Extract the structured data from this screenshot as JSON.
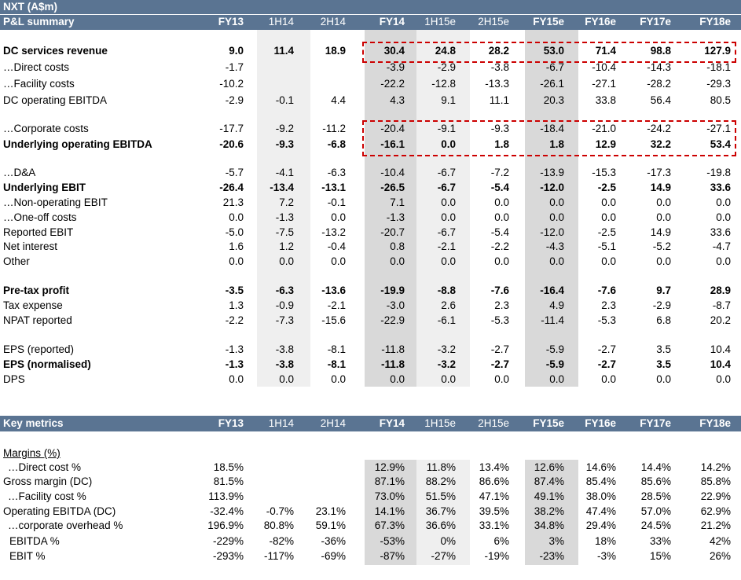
{
  "pl": {
    "title1": "NXT  (A$m)",
    "title2": "P&L summary",
    "columns": [
      "FY13",
      "1H14",
      "2H14",
      "FY14",
      "1H15e",
      "2H15e",
      "FY15e",
      "FY16e",
      "FY17e",
      "FY18e"
    ],
    "rows": [
      {
        "label": "DC services revenue",
        "bold": true,
        "values": [
          "9.0",
          "11.4",
          "18.9",
          "30.4",
          "24.8",
          "28.2",
          "53.0",
          "71.4",
          "98.8",
          "127.9"
        ]
      },
      {
        "label": "…Direct costs",
        "bold": false,
        "values": [
          "-1.7",
          "",
          "",
          "-3.9",
          "-2.9",
          "-3.8",
          "-6.7",
          "-10.4",
          "-14.3",
          "-18.1"
        ]
      },
      {
        "label": "…Facility costs",
        "bold": false,
        "values": [
          "-10.2",
          "",
          "",
          "-22.2",
          "-12.8",
          "-13.3",
          "-26.1",
          "-27.1",
          "-28.2",
          "-29.3"
        ]
      },
      {
        "label": "DC operating EBITDA",
        "bold": false,
        "values": [
          "-2.9",
          "-0.1",
          "4.4",
          "4.3",
          "9.1",
          "11.1",
          "20.3",
          "33.8",
          "56.4",
          "80.5"
        ]
      },
      {
        "label": "…Corporate costs",
        "bold": false,
        "values": [
          "-17.7",
          "-9.2",
          "-11.2",
          "-20.4",
          "-9.1",
          "-9.3",
          "-18.4",
          "-21.0",
          "-24.2",
          "-27.1"
        ]
      },
      {
        "label": "Underlying operating EBITDA",
        "bold": true,
        "values": [
          "-20.6",
          "-9.3",
          "-6.8",
          "-16.1",
          "0.0",
          "1.8",
          "1.8",
          "12.9",
          "32.2",
          "53.4"
        ]
      },
      {
        "label": "…D&A",
        "bold": false,
        "values": [
          "-5.7",
          "-4.1",
          "-6.3",
          "-10.4",
          "-6.7",
          "-7.2",
          "-13.9",
          "-15.3",
          "-17.3",
          "-19.8"
        ]
      },
      {
        "label": "Underlying EBIT",
        "bold": true,
        "values": [
          "-26.4",
          "-13.4",
          "-13.1",
          "-26.5",
          "-6.7",
          "-5.4",
          "-12.0",
          "-2.5",
          "14.9",
          "33.6"
        ]
      },
      {
        "label": "…Non-operating EBIT",
        "bold": false,
        "values": [
          "21.3",
          "7.2",
          "-0.1",
          "7.1",
          "0.0",
          "0.0",
          "0.0",
          "0.0",
          "0.0",
          "0.0"
        ]
      },
      {
        "label": "…One-off costs",
        "bold": false,
        "values": [
          "0.0",
          "-1.3",
          "0.0",
          "-1.3",
          "0.0",
          "0.0",
          "0.0",
          "0.0",
          "0.0",
          "0.0"
        ]
      },
      {
        "label": "Reported EBIT",
        "bold": false,
        "values": [
          "-5.0",
          "-7.5",
          "-13.2",
          "-20.7",
          "-6.7",
          "-5.4",
          "-12.0",
          "-2.5",
          "14.9",
          "33.6"
        ]
      },
      {
        "label": "Net interest",
        "bold": false,
        "values": [
          "1.6",
          "1.2",
          "-0.4",
          "0.8",
          "-2.1",
          "-2.2",
          "-4.3",
          "-5.1",
          "-5.2",
          "-4.7"
        ]
      },
      {
        "label": "Other",
        "bold": false,
        "values": [
          "0.0",
          "0.0",
          "0.0",
          "0.0",
          "0.0",
          "0.0",
          "0.0",
          "0.0",
          "0.0",
          "0.0"
        ]
      },
      {
        "label": "Pre-tax profit",
        "bold": true,
        "values": [
          "-3.5",
          "-6.3",
          "-13.6",
          "-19.9",
          "-8.8",
          "-7.6",
          "-16.4",
          "-7.6",
          "9.7",
          "28.9"
        ]
      },
      {
        "label": "Tax expense",
        "bold": false,
        "values": [
          "1.3",
          "-0.9",
          "-2.1",
          "-3.0",
          "2.6",
          "2.3",
          "4.9",
          "2.3",
          "-2.9",
          "-8.7"
        ]
      },
      {
        "label": "NPAT reported",
        "bold": false,
        "values": [
          "-2.2",
          "-7.3",
          "-15.6",
          "-22.9",
          "-6.1",
          "-5.3",
          "-11.4",
          "-5.3",
          "6.8",
          "20.2"
        ]
      },
      {
        "label": "EPS (reported)",
        "bold": false,
        "values": [
          "-1.3",
          "-3.8",
          "-8.1",
          "-11.8",
          "-3.2",
          "-2.7",
          "-5.9",
          "-2.7",
          "3.5",
          "10.4"
        ]
      },
      {
        "label": "EPS (normalised)",
        "bold": true,
        "values": [
          "-1.3",
          "-3.8",
          "-8.1",
          "-11.8",
          "-3.2",
          "-2.7",
          "-5.9",
          "-2.7",
          "3.5",
          "10.4"
        ]
      },
      {
        "label": "DPS",
        "bold": false,
        "values": [
          "0.0",
          "0.0",
          "0.0",
          "0.0",
          "0.0",
          "0.0",
          "0.0",
          "0.0",
          "0.0",
          "0.0"
        ]
      }
    ]
  },
  "km": {
    "title": "Key metrics",
    "columns": [
      "FY13",
      "1H14",
      "2H14",
      "FY14",
      "1H15e",
      "2H15e",
      "FY15e",
      "FY16e",
      "FY17e",
      "FY18e"
    ],
    "section": "Margins (%)",
    "rows": [
      {
        "label": "…Direct cost %",
        "values": [
          "18.5%",
          "",
          "",
          "12.9%",
          "11.8%",
          "13.4%",
          "12.6%",
          "14.6%",
          "14.4%",
          "14.2%"
        ]
      },
      {
        "label": "Gross margin (DC)",
        "values": [
          "81.5%",
          "",
          "",
          "87.1%",
          "88.2%",
          "86.6%",
          "87.4%",
          "85.4%",
          "85.6%",
          "85.8%"
        ]
      },
      {
        "label": "…Facility cost %",
        "values": [
          "113.9%",
          "",
          "",
          "73.0%",
          "51.5%",
          "47.1%",
          "49.1%",
          "38.0%",
          "28.5%",
          "22.9%"
        ]
      },
      {
        "label": "Operating EBITDA  (DC)",
        "values": [
          "-32.4%",
          "-0.7%",
          "23.1%",
          "14.1%",
          "36.7%",
          "39.5%",
          "38.2%",
          "47.4%",
          "57.0%",
          "62.9%"
        ]
      },
      {
        "label": "…corporate overhead %",
        "values": [
          "196.9%",
          "80.8%",
          "59.1%",
          "67.3%",
          "36.6%",
          "33.1%",
          "34.8%",
          "29.4%",
          "24.5%",
          "21.2%"
        ]
      },
      {
        "label": "EBITDA %",
        "values": [
          "-229%",
          "-82%",
          "-36%",
          "-53%",
          "0%",
          "6%",
          "3%",
          "18%",
          "33%",
          "42%"
        ]
      },
      {
        "label": "EBIT %",
        "values": [
          "-293%",
          "-117%",
          "-69%",
          "-87%",
          "-27%",
          "-19%",
          "-23%",
          "-3%",
          "15%",
          "26%"
        ]
      }
    ]
  },
  "colors": {
    "header": "#5a7492",
    "shade_light": "#efefef",
    "shade_dark": "#d9d9d9",
    "highlight": "#cc0000"
  }
}
